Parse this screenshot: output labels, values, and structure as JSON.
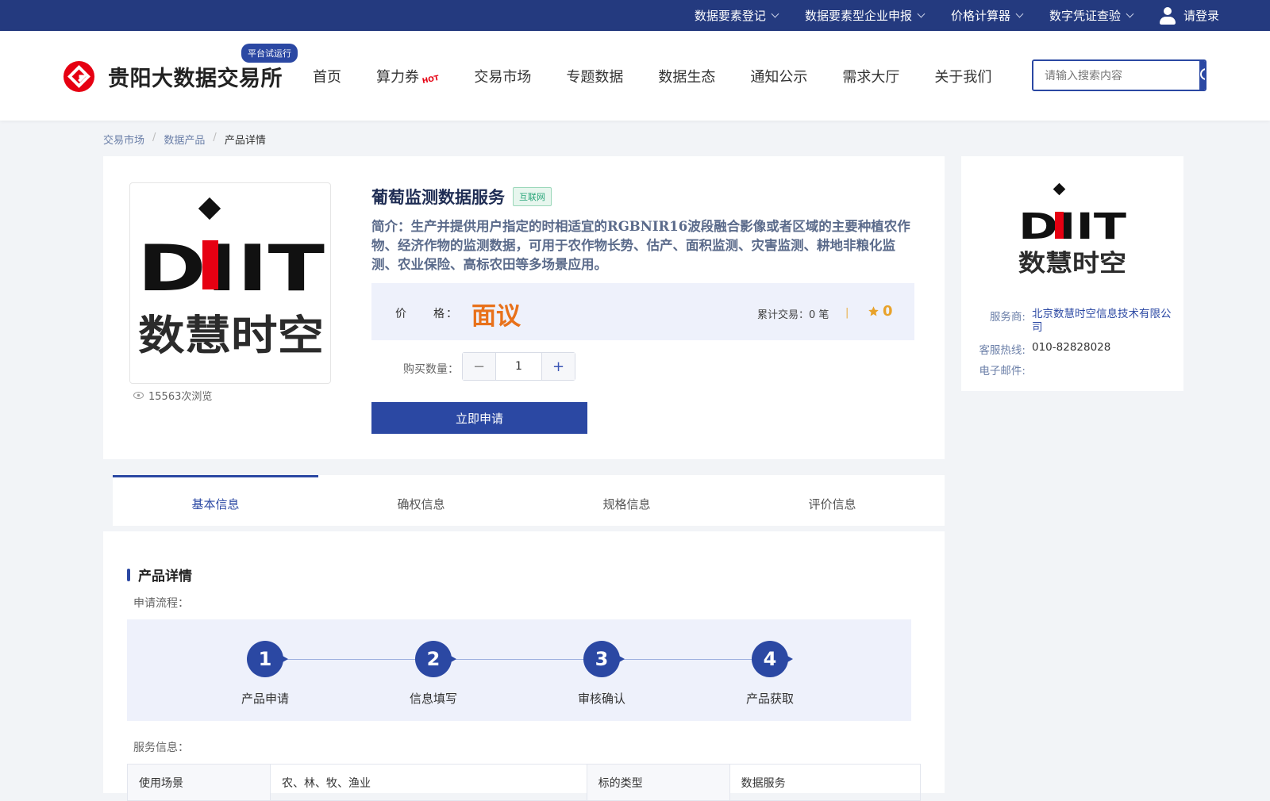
{
  "topbar": {
    "menu": [
      {
        "label": "数据要素登记"
      },
      {
        "label": "数据要素型企业申报"
      },
      {
        "label": "价格计算器"
      },
      {
        "label": "数字凭证查验"
      }
    ],
    "login_label": "请登录"
  },
  "header": {
    "brand": "贵阳大数据交易所",
    "badge": "平台试运行",
    "nav": [
      {
        "label": "首页"
      },
      {
        "label": "算力券",
        "hot": "HOT"
      },
      {
        "label": "交易市场"
      },
      {
        "label": "专题数据"
      },
      {
        "label": "数据生态"
      },
      {
        "label": "通知公示"
      },
      {
        "label": "需求大厅"
      },
      {
        "label": "关于我们"
      }
    ],
    "search_placeholder": "请输入搜索内容"
  },
  "breadcrumb": {
    "items": [
      "交易市场",
      "数据产品"
    ],
    "separator": "/",
    "current": "产品详情"
  },
  "product": {
    "title": "葡萄监测数据服务",
    "tag": "互联网",
    "intro": "简介：生产并提供用户指定的时相适宜的RGBNIR16波段融合影像或者区域的主要种植农作物、经济作物的监测数据，可用于农作物长势、估产、面积监测、灾害监测、耕地非粮化监测、农业保险、高标农田等多场景应用。",
    "price_label": "价　　格：",
    "price_value": "面议",
    "trade_text": "累计交易：0 笔",
    "trade_divider": "|",
    "rating": "0",
    "views": "15563次浏览",
    "qty_label": "购买数量：",
    "qty_value": "1",
    "minus": "−",
    "plus": "+",
    "apply_label": "立即申请",
    "logo_text_top": "DIIT",
    "logo_text_bottom": "数慧时空"
  },
  "provider": {
    "service_key": "服务商:",
    "service_val": "北京数慧时空信息技术有限公司",
    "hotline_key": "客服热线:",
    "hotline_val": "010-82828028",
    "email_key": "电子邮件:",
    "email_val": ""
  },
  "tabs": [
    {
      "label": "基本信息",
      "active": true
    },
    {
      "label": "确权信息"
    },
    {
      "label": "规格信息"
    },
    {
      "label": "评价信息"
    }
  ],
  "detail": {
    "title": "产品详情",
    "flow_label": "申请流程：",
    "steps": [
      {
        "num": "1",
        "label": "产品申请"
      },
      {
        "num": "2",
        "label": "信息填写"
      },
      {
        "num": "3",
        "label": "审核确认"
      },
      {
        "num": "4",
        "label": "产品获取"
      }
    ],
    "service_label": "服务信息：",
    "table": [
      {
        "k1": "使用场景",
        "v1": "农、林、牧、渔业",
        "k2": "标的类型",
        "v2": "数据服务"
      }
    ]
  },
  "colors": {
    "primary": "#2b48a3",
    "topbar": "#243a7f",
    "price": "#e8711a",
    "logo_red": "#e60012"
  }
}
